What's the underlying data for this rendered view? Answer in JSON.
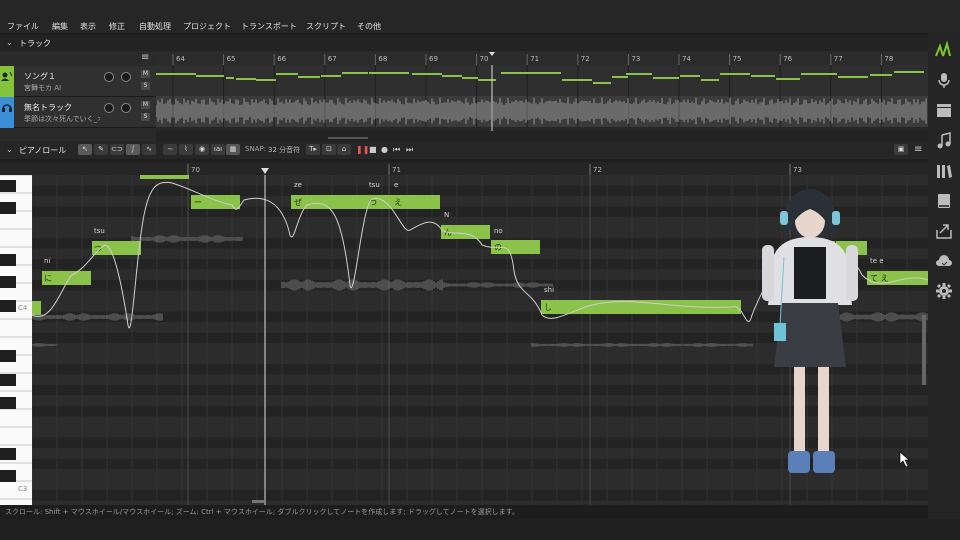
{
  "menu": [
    "ファイル",
    "編集",
    "表示",
    "修正",
    "自動処理",
    "プロジェクト",
    "トランスポート",
    "スクリプト",
    "その他"
  ],
  "track_section": {
    "title": "トラック"
  },
  "tracks": [
    {
      "name": "ソング１",
      "singer": "宮舞モカ AI",
      "color": "#84c43a"
    },
    {
      "name": "無名トラック",
      "subtitle": "季節は次々死んでいく_オケ",
      "color": "#3a8fd6"
    }
  ],
  "track_ruler": [
    "64",
    "65",
    "66",
    "67",
    "68",
    "69",
    "70",
    "71",
    "72",
    "73",
    "74",
    "75",
    "76",
    "77",
    "78"
  ],
  "mute_label": "M",
  "solo_label": "S",
  "pianoroll": {
    "title": "ピアノロール",
    "snap_label": "SNAP:",
    "snap_value": "32 分音符",
    "ruler": [
      "70",
      "71",
      "72",
      "73"
    ],
    "key_labels": [
      "C4",
      "C3"
    ]
  },
  "notes": [
    {
      "lyric": "に",
      "phoneme": "ni"
    },
    {
      "lyric": "つ",
      "phoneme": "tsu"
    },
    {
      "lyric": "ー",
      "phoneme": ""
    },
    {
      "lyric": "ぜ",
      "phoneme": "ze"
    },
    {
      "lyric": "つ",
      "phoneme": "tsu"
    },
    {
      "lyric": "え",
      "phoneme": "e"
    },
    {
      "lyric": "ん",
      "phoneme": "N"
    },
    {
      "lyric": "の",
      "phoneme": "no"
    },
    {
      "lyric": "し",
      "phoneme": "shi"
    },
    {
      "lyric": "さ ー い",
      "phoneme": ""
    },
    {
      "lyric": "て   え",
      "phoneme": "te     e"
    }
  ],
  "status": "スクロール: Shift + マウスホイール/マウスホイール; ズーム: Ctrl + マウスホイール; ダブルクリックしてノートを作成します; ドラッグしてノートを選択します。",
  "colors": {
    "note": "#8bc34a",
    "accent": "#7ec631",
    "bg": "#2a2a2a"
  }
}
